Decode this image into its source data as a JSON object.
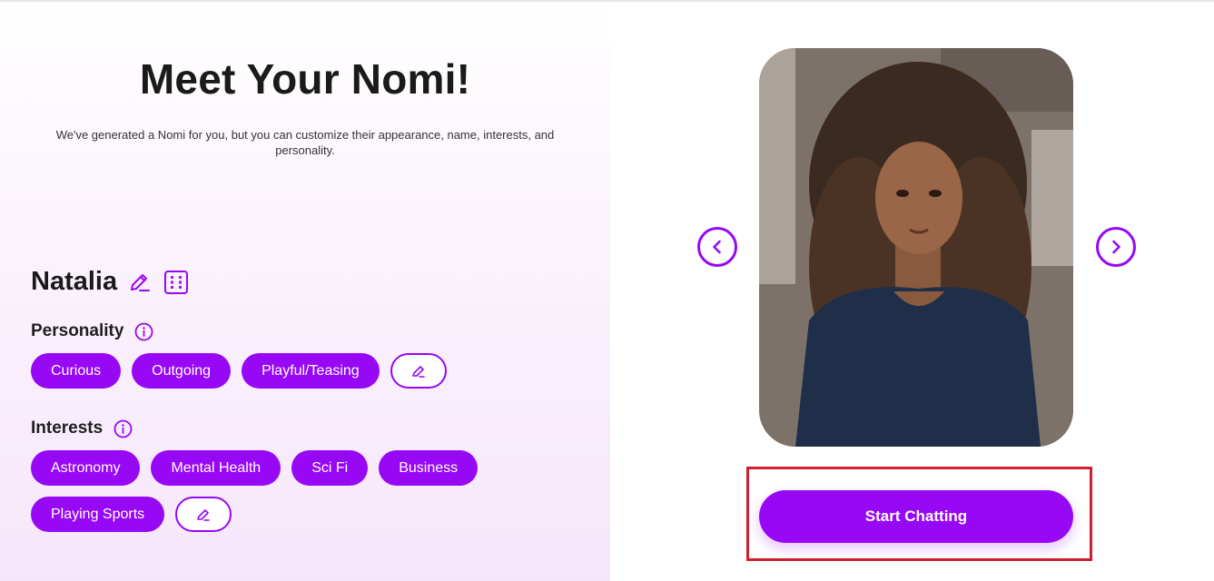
{
  "header": {
    "title": "Meet Your Nomi!",
    "subtitle": "We've generated a Nomi for you, but you can customize their appearance, name, interests, and personality."
  },
  "nomi": {
    "name": "Natalia",
    "icons": {
      "edit": "pencil-icon",
      "randomize": "dice-icon"
    }
  },
  "personality": {
    "label": "Personality",
    "info_icon": "info-icon",
    "traits": [
      "Curious",
      "Outgoing",
      "Playful/Teasing"
    ],
    "edit_icon": "pencil-icon"
  },
  "interests": {
    "label": "Interests",
    "info_icon": "info-icon",
    "items": [
      "Astronomy",
      "Mental Health",
      "Sci Fi",
      "Business",
      "Playing Sports"
    ],
    "edit_icon": "pencil-icon"
  },
  "carousel": {
    "prev_icon": "chevron-left-icon",
    "next_icon": "chevron-right-icon"
  },
  "actions": {
    "start_label": "Start Chatting"
  },
  "colors": {
    "accent": "#9708f5",
    "highlight_border": "#d11f2f",
    "panel_gradient_end": "#f5e7fa"
  }
}
